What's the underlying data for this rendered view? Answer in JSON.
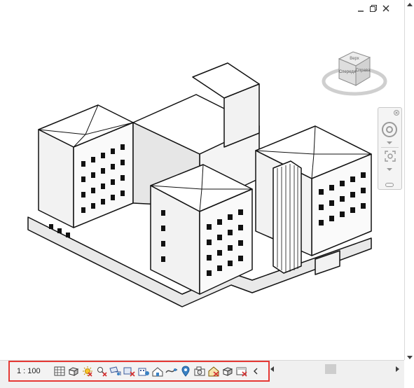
{
  "view": {
    "scale_label": "1 : 100",
    "viewcube_faces": {
      "top": "Верх",
      "front": "Спереди",
      "right": "Справа"
    }
  },
  "window_controls": {
    "icons": [
      "minimize-icon",
      "restore-icon",
      "close-icon"
    ]
  },
  "view_control_bar": {
    "icons": [
      "detail-level-icon",
      "visual-style-icon",
      "sun-path-icon",
      "shadows-icon",
      "crop-view-icon",
      "show-crop-region-icon",
      "unlock-3d-view-icon",
      "temporary-hide-isolate-icon",
      "reveal-hidden-elements-icon",
      "temporary-view-properties-icon",
      "analytical-model-icon",
      "highlight-displacement-icon",
      "reveal-constraints-icon",
      "save-orientation-icon",
      "lock-view-icon"
    ],
    "highlight_color": "#e53935"
  }
}
